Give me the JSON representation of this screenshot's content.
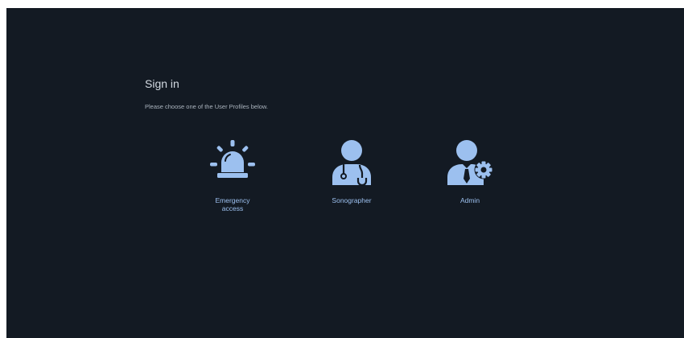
{
  "signin": {
    "title": "Sign in",
    "instructions": "Please choose one of the User Profiles below."
  },
  "profiles": [
    {
      "id": "emergency",
      "label_line1": "Emergency",
      "label_line2": "access",
      "icon": "siren-icon"
    },
    {
      "id": "sonographer",
      "label": "Sonographer",
      "icon": "doctor-stethoscope-icon"
    },
    {
      "id": "admin",
      "label": "Admin",
      "icon": "user-gear-icon"
    }
  ],
  "colors": {
    "background": "#131a23",
    "accent": "#9cc0ef",
    "title_text": "#d3dae2",
    "body_text": "#aab3bd"
  }
}
